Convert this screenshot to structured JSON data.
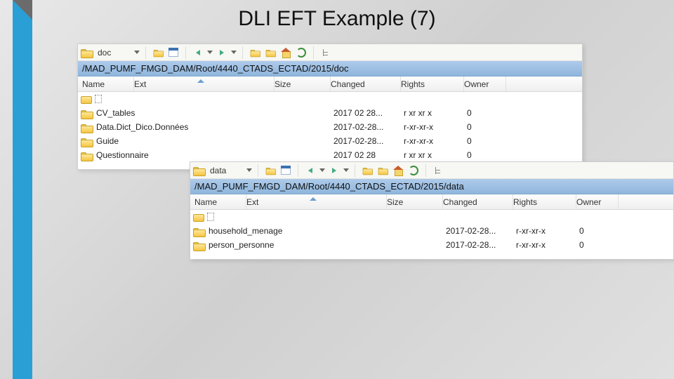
{
  "slide": {
    "title": "DLI EFT Example (7)"
  },
  "headers": {
    "name": "Name",
    "ext": "Ext",
    "size": "Size",
    "changed": "Changed",
    "rights": "Rights",
    "owner": "Owner"
  },
  "browser1": {
    "dir_label": "doc",
    "path": "/MAD_PUMF_FMGD_DAM/Root/4440_CTADS_ECTAD/2015/doc",
    "rows": [
      {
        "name": "CV_tables",
        "changed": "2017 02 28...",
        "rights": "r xr xr x",
        "owner": "0"
      },
      {
        "name": "Data.Dict_Dico.Données",
        "changed": "2017-02-28...",
        "rights": "r-xr-xr-x",
        "owner": "0"
      },
      {
        "name": "Guide",
        "changed": "2017-02-28...",
        "rights": "r-xr-xr-x",
        "owner": "0"
      },
      {
        "name": "Questionnaire",
        "changed": "2017 02 28",
        "rights": "r xr xr x",
        "owner": "0"
      }
    ]
  },
  "browser2": {
    "dir_label": "data",
    "path": "/MAD_PUMF_FMGD_DAM/Root/4440_CTADS_ECTAD/2015/data",
    "rows": [
      {
        "name": "household_menage",
        "changed": "2017-02-28...",
        "rights": "r-xr-xr-x",
        "owner": "0"
      },
      {
        "name": "person_personne",
        "changed": "2017-02-28...",
        "rights": "r-xr-xr-x",
        "owner": "0"
      }
    ]
  }
}
